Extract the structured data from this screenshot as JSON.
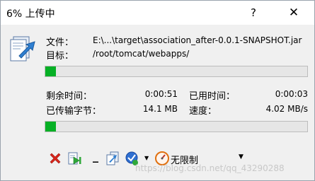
{
  "window": {
    "title": "6% 上传中",
    "help_label": "?",
    "close_label": "✕"
  },
  "transfer": {
    "file_label": "文件：",
    "file_value": "E:\\...\\target\\association_after-0.0.1-SNAPSHOT.jar",
    "target_label": "目标：",
    "target_value": "/root/tomcat/webapps/",
    "file_progress": 0.04
  },
  "stats": {
    "remaining_label": "剩余时间：",
    "remaining_value": "0:00:51",
    "elapsed_label": "已用时间：",
    "elapsed_value": "0:00:03",
    "transferred_label": "已传输字节：",
    "transferred_value": "14.1 MB",
    "speed_label": "速度：",
    "speed_value": "4.02 MB/s",
    "total_progress": 0.04
  },
  "toolbar": {
    "speed_limit_label": "无限制",
    "minimize_label": "_",
    "dropdown_arrow": "▼"
  },
  "watermark": "https://blog.csdn.net/qq_43290288",
  "icons": {
    "cancel": "cancel-icon",
    "skip": "skip-icon",
    "queue": "queue-icon",
    "check": "check-icon",
    "speed": "speedometer-icon",
    "file": "file-transfer-icon"
  },
  "colors": {
    "progress": "#06b025",
    "cancel": "#d9261c"
  }
}
